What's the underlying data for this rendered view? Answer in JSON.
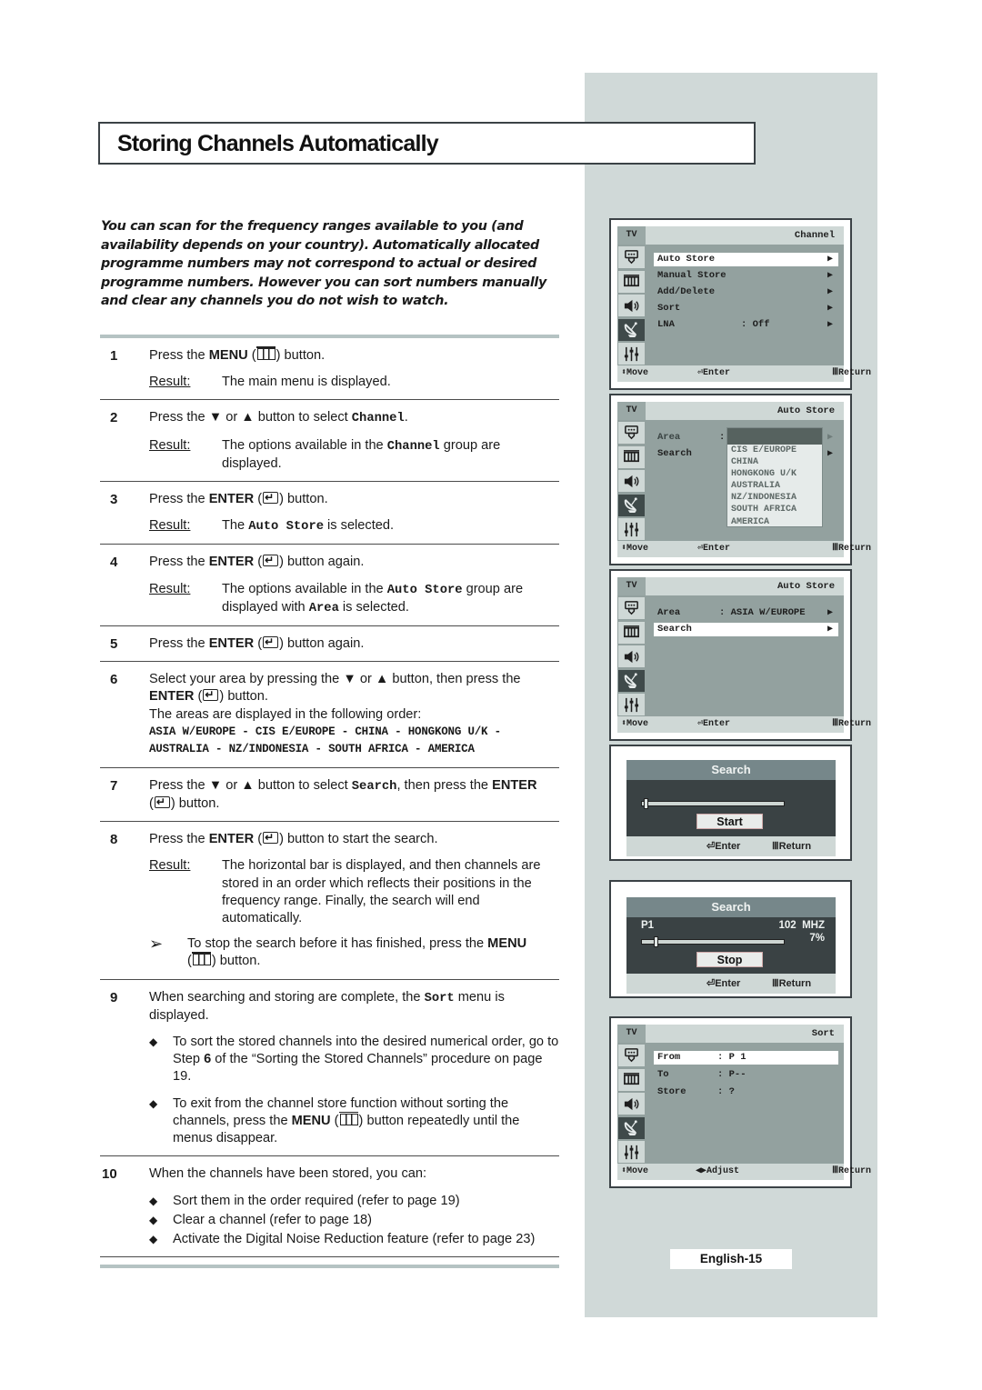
{
  "page": {
    "title": "Storing Channels Automatically",
    "intro": "You can scan for the frequency ranges available to you (and availability depends on your country). Automatically allocated programme numbers may not correspond to actual or desired programme numbers. However you can sort numbers manually and clear any channels you do not wish to watch.",
    "page_label": "English-15"
  },
  "labels": {
    "result": "Result:",
    "menu": "MENU",
    "enter": "ENTER"
  },
  "steps": [
    {
      "num": "1",
      "pre": "Press the ",
      "bold": "MENU",
      "post": " button.",
      "icon": "menu",
      "result": "The main menu is displayed."
    },
    {
      "num": "2",
      "text_a": "Press the ▼ or ▲ button to select ",
      "mono": "Channel",
      "text_b": ".",
      "result_a": "The options available in the ",
      "result_mono": "Channel",
      "result_b": " group are displayed."
    },
    {
      "num": "3",
      "pre": "Press the ",
      "bold": "ENTER",
      "post": " button.",
      "icon": "enter",
      "result_a": "The ",
      "result_mono": "Auto Store",
      "result_b": " is selected."
    },
    {
      "num": "4",
      "pre": "Press the ",
      "bold": "ENTER",
      "post": " button again.",
      "icon": "enter",
      "result_a": "The options available in the ",
      "result_mono": "Auto Store",
      "result_b": " group are displayed with ",
      "result_mono2": "Area",
      "result_c": " is selected."
    },
    {
      "num": "5",
      "pre": "Press the ",
      "bold": "ENTER",
      "post": " button again.",
      "icon": "enter"
    },
    {
      "num": "6",
      "text_a": "Select your area by pressing the ▼ or ▲ button, then press the ",
      "bold": "ENTER",
      "post": " button.",
      "text_c": "The areas are displayed in the following order:",
      "areas_line1": "ASIA W/EUROPE - CIS E/EUROPE - CHINA - HONGKONG U/K -",
      "areas_line2": "AUSTRALIA - NZ/INDONESIA - SOUTH AFRICA - AMERICA"
    },
    {
      "num": "7",
      "text_a": "Press the ▼ or ▲ button to select ",
      "mono": "Search",
      "text_b": ", then press the ",
      "bold": "ENTER",
      "post": " button."
    },
    {
      "num": "8",
      "pre": "Press the ",
      "bold": "ENTER",
      "post": " button to start the search.",
      "result": "The horizontal bar is displayed, and then channels are stored in an order which reflects their positions in the frequency range. Finally, the search will end automatically.",
      "note_arrow": "➢",
      "note_pre": "To stop the search before it has finished, press the ",
      "note_bold": "MENU",
      "note_post": " button."
    },
    {
      "num": "9",
      "text_a": "When searching and storing are complete, the ",
      "mono": "Sort",
      "text_b": " menu is displayed.",
      "bullets": [
        {
          "a": "To sort the stored channels into the desired numerical order, go to Step ",
          "b": "6",
          "c": " of the “Sorting the Stored Channels” procedure on page 19."
        },
        {
          "a": "To exit from the channel store function without sorting the channels, press the ",
          "b": "MENU",
          "c": " button repeatedly until the menus disappear."
        }
      ]
    },
    {
      "num": "10",
      "text": "When the channels have been stored, you can:",
      "bullets": [
        "Sort them in the order required (refer to page 19)",
        "Clear a channel (refer to page 18)",
        "Activate the Digital Noise Reduction feature (refer to page 23)"
      ]
    }
  ],
  "bullet_mark": "◆",
  "osd_common": {
    "tv": "TV",
    "move": "Move",
    "enter": "Enter",
    "return": "Return",
    "adjust": "Adjust",
    "arrow": "▶",
    "icons": [
      "picture-icon",
      "menu-grid-icon",
      "sound-icon",
      "channel-antenna-icon",
      "setup-sliders-icon"
    ],
    "active_icon_index": 3
  },
  "osd_channel": {
    "heading": "Channel",
    "items": [
      {
        "label": "Auto Store",
        "value": "",
        "selected": true
      },
      {
        "label": "Manual Store",
        "value": "",
        "selected": false
      },
      {
        "label": "Add/Delete",
        "value": "",
        "selected": false
      },
      {
        "label": "Sort",
        "value": "",
        "selected": false
      },
      {
        "label": "LNA",
        "value": ": Off",
        "selected": false
      }
    ]
  },
  "osd_autostore_dropdown": {
    "heading": "Auto Store",
    "area_label": "Area",
    "area_sep": ":",
    "search_label": "Search",
    "options": [
      "CIS E/EUROPE",
      "CHINA",
      "HONGKONG U/K",
      "AUSTRALIA",
      "NZ/INDONESIA",
      "SOUTH AFRICA",
      "AMERICA"
    ]
  },
  "osd_autostore": {
    "heading": "Auto Store",
    "area_label": "Area",
    "area_value": ": ASIA W/EUROPE",
    "search_label": "Search"
  },
  "search_start": {
    "title": "Search",
    "button": "Start",
    "progress": 0.0,
    "enter": "Enter",
    "return": "Return"
  },
  "search_running": {
    "title": "Search",
    "program": "P1",
    "frequency": "102  MHZ",
    "percent": "7%",
    "progress": 0.07,
    "button": "Stop",
    "enter": "Enter",
    "return": "Return"
  },
  "osd_sort": {
    "heading": "Sort",
    "items": [
      {
        "label": "From",
        "value": ": P 1",
        "selected": true
      },
      {
        "label": "To",
        "value": ": P--",
        "selected": false
      },
      {
        "label": "Store",
        "value": ": ?",
        "selected": false
      }
    ]
  }
}
